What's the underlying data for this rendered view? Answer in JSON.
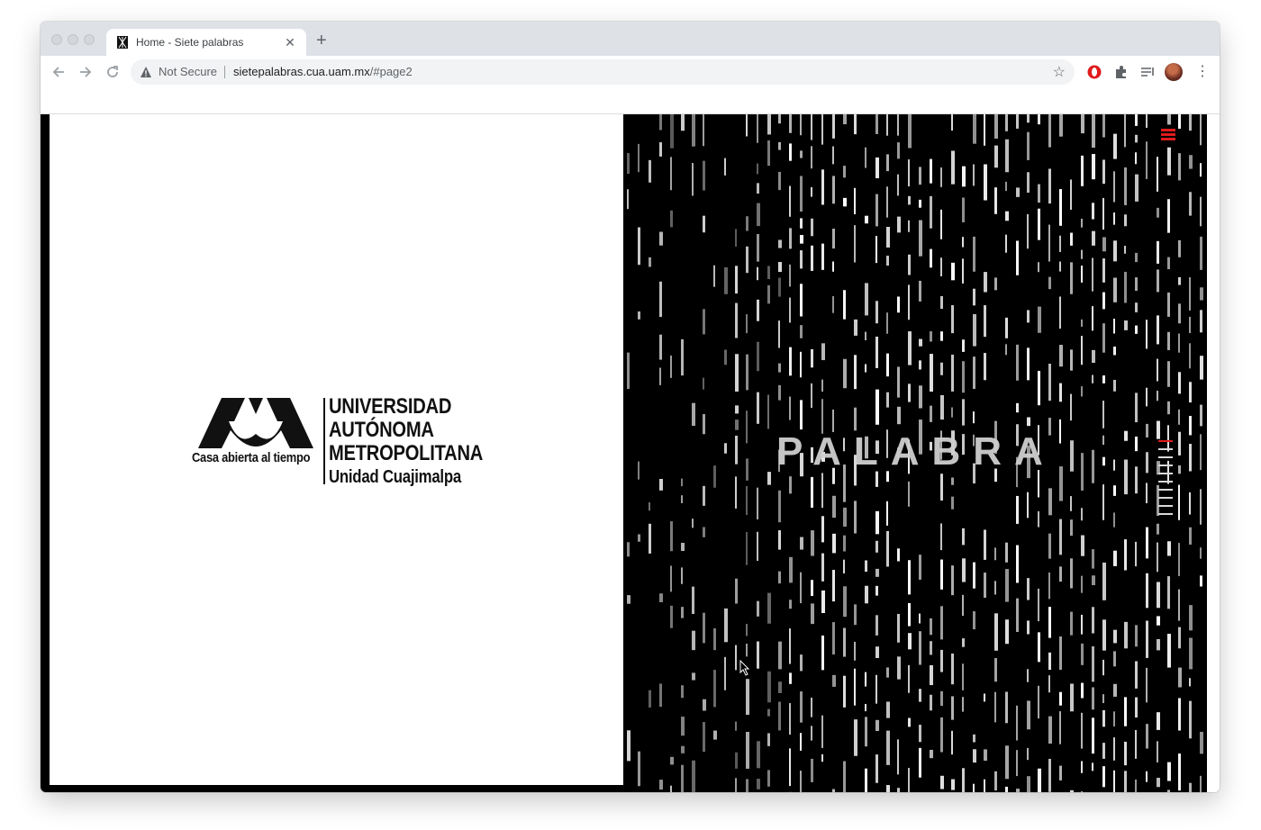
{
  "browser": {
    "tab": {
      "title": "Home - Siete palabras"
    },
    "omnibox": {
      "security_label": "Not Secure",
      "url_host": "sietepalabras.cua.uam.mx",
      "url_path": "/#page2"
    }
  },
  "page": {
    "logo": {
      "tagline": "Casa abierta al tiempo",
      "line1": "UNIVERSIDAD",
      "line2": "AUTÓNOMA",
      "line3": "METROPOLITANA",
      "line4": "Unidad Cuajimalpa"
    },
    "headline": "PALABRA",
    "pager": {
      "count": 10,
      "active_index": 0
    }
  },
  "colors": {
    "accent": "#e01b1b",
    "tabstrip": "#dee1e6",
    "omnibox": "#f1f3f4"
  },
  "icons": [
    "back-arrow-icon",
    "forward-arrow-icon",
    "reload-icon",
    "warning-icon",
    "star-icon",
    "opera-icon",
    "puzzle-extension-icon",
    "reading-list-icon",
    "profile-avatar",
    "more-menu-icon",
    "hamburger-menu-icon",
    "cursor-icon"
  ]
}
